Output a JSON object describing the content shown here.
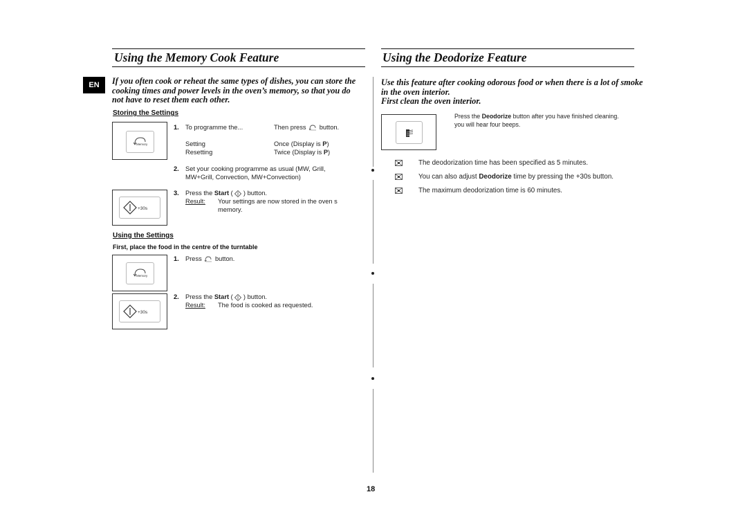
{
  "language_badge": "EN",
  "page_number": "18",
  "memory_cook": {
    "title": "Using the Memory Cook Feature",
    "intro": [
      "If you often cook or reheat the same types of dishes, you can store the",
      "cooking times and power levels in the oven’s memory, so that you do",
      "not have to reset them each other."
    ],
    "storing": {
      "heading": "Storing the Settings",
      "step1": {
        "number": "1.",
        "col1_header": "To programme the...",
        "col2_header_pre": "Then press",
        "col2_header_post": "button.",
        "rows": [
          {
            "mode": "Setting",
            "press_pre": "Once (Display is ",
            "display": "P",
            "press_post": ")"
          },
          {
            "mode": "Resetting",
            "press_pre": "Twice (Display is ",
            "display": "P",
            "press_post": ")"
          }
        ]
      },
      "step2": {
        "number": "2.",
        "lines": [
          "Set your cooking programme as usual (MW, Grill,",
          "MW+Grill, Convection, MW+Convection)"
        ]
      },
      "step3": {
        "number": "3.",
        "pre": "Press the ",
        "bold": "Start",
        "post_open": " ( ",
        "post_close": " ) button.",
        "result_label": "Result:",
        "result_lines": [
          "Your settings are now stored in the oven s",
          "memory."
        ]
      }
    },
    "using": {
      "heading": "Using the Settings",
      "note": "First, place the food in the centre of the turntable",
      "step1": {
        "number": "1.",
        "pre": "Press",
        "post": "button."
      },
      "step2": {
        "number": "2.",
        "pre": "Press the ",
        "bold": "Start",
        "post_open": " ( ",
        "post_close": " ) button.",
        "result_label": "Result:",
        "result_text": "The food is cooked as requested."
      }
    },
    "button_labels": {
      "memory": "Memory",
      "plus30": "+30s"
    }
  },
  "deodorize": {
    "title": "Using the Deodorize Feature",
    "intro": [
      "Use this feature after cooking odorous food or when there is a lot of smoke",
      "in the oven interior.",
      "First clean the oven interior."
    ],
    "instruction": {
      "pre": "Press the ",
      "bold": "Deodorize",
      "post": " button after you have finished cleaning.",
      "line2": "you will hear four beeps."
    },
    "notes": [
      {
        "icon": "note-icon",
        "pre": "The deodorization time has been specified as 5 minutes.",
        "bold": "",
        "post": ""
      },
      {
        "icon": "note-icon",
        "pre": "You can also adjust ",
        "bold": "Deodorize",
        "post": " time by pressing the +30s button."
      },
      {
        "icon": "note-icon",
        "pre": "The maximum deodorization time is 60 minutes.",
        "bold": "",
        "post": ""
      }
    ]
  }
}
